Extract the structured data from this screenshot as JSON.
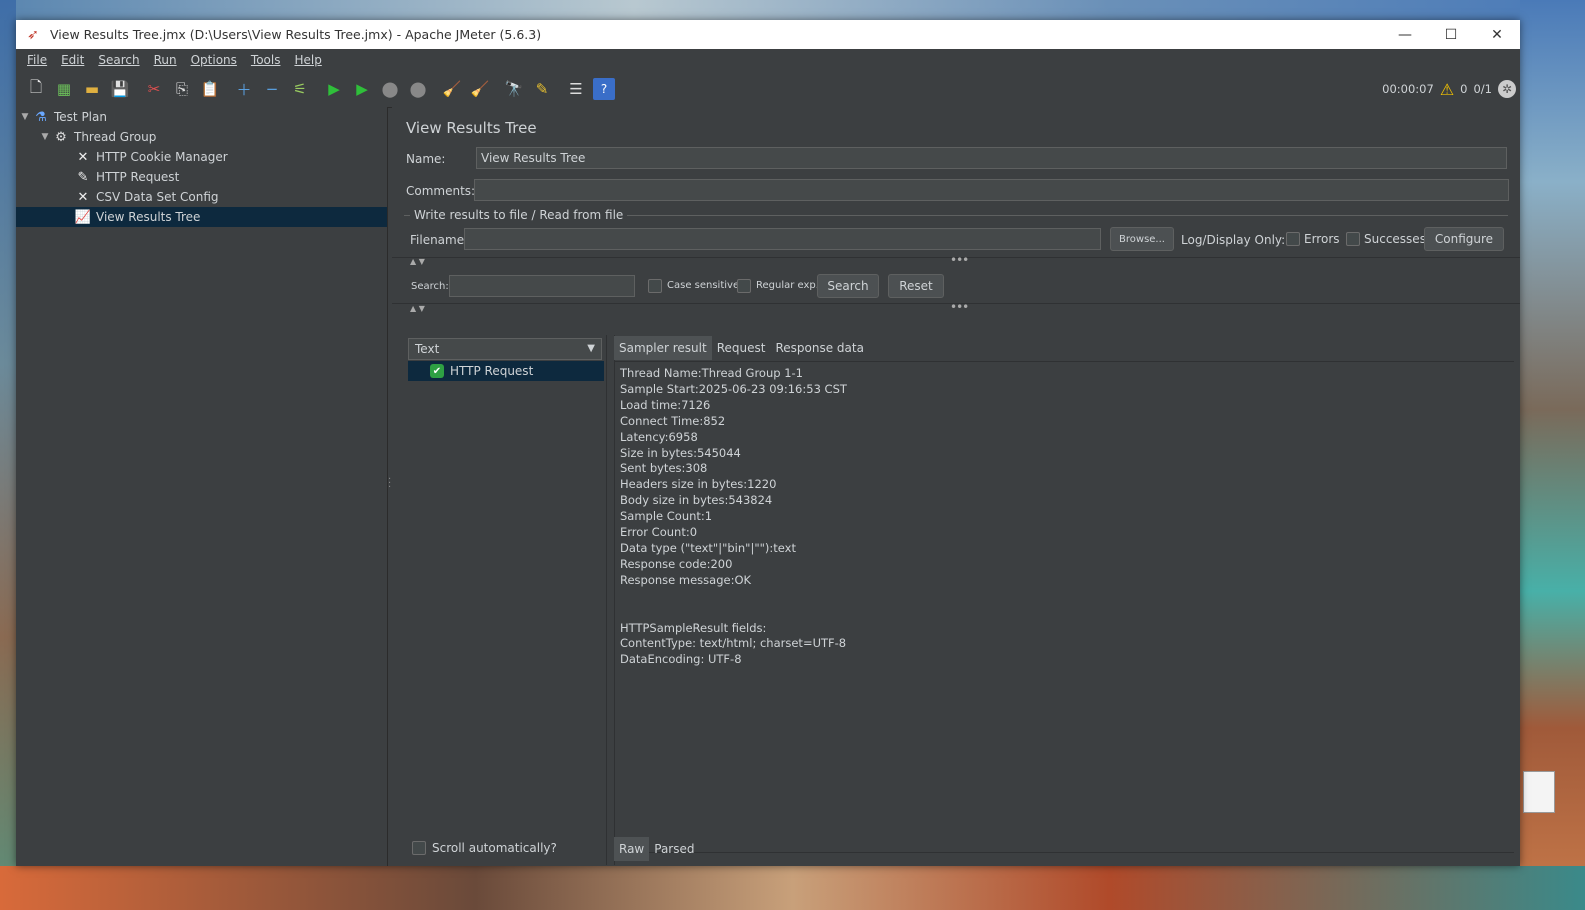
{
  "window": {
    "title": "View Results Tree.jmx (D:\\Users\\View Results Tree.jmx) - Apache JMeter (5.6.3)",
    "controls": [
      "minimize",
      "maximize",
      "close"
    ]
  },
  "menu": [
    {
      "label": "File",
      "mnemonic": "F"
    },
    {
      "label": "Edit",
      "mnemonic": "E"
    },
    {
      "label": "Search",
      "mnemonic": "S"
    },
    {
      "label": "Run",
      "mnemonic": "R"
    },
    {
      "label": "Options",
      "mnemonic": "O"
    },
    {
      "label": "Tools",
      "mnemonic": "T"
    },
    {
      "label": "Help",
      "mnemonic": "H"
    }
  ],
  "toolbar": {
    "elapsed": "00:00:07",
    "warnings": "0",
    "threads": "0/1"
  },
  "tree": [
    {
      "label": "Test Plan",
      "icon": "test-plan-icon"
    },
    {
      "label": "Thread Group",
      "icon": "gear-icon"
    },
    {
      "label": "HTTP Cookie Manager",
      "icon": "tools-icon"
    },
    {
      "label": "HTTP Request",
      "icon": "pipette-icon"
    },
    {
      "label": "CSV Data Set Config",
      "icon": "tools-icon"
    },
    {
      "label": "View Results Tree",
      "icon": "chart-icon",
      "selected": true
    }
  ],
  "panel": {
    "title": "View Results Tree",
    "name_label": "Name:",
    "name_value": "View Results Tree",
    "comments_label": "Comments:",
    "comments_value": "",
    "file_group": "Write results to file / Read from file",
    "filename_label": "Filename",
    "filename_value": "",
    "browse": "Browse...",
    "log_display": "Log/Display Only:",
    "errors": "Errors",
    "successes": "Successes",
    "configure": "Configure"
  },
  "search": {
    "label": "Search:",
    "value": "",
    "case_sensitive": "Case sensitive",
    "regular_exp": "Regular exp.",
    "search_btn": "Search",
    "reset_btn": "Reset"
  },
  "results": {
    "renderer": "Text",
    "items": [
      {
        "label": "HTTP Request",
        "status": "success"
      }
    ],
    "scroll_auto": "Scroll automatically?"
  },
  "tabs": [
    "Sampler result",
    "Request",
    "Response data"
  ],
  "detail_lines": [
    "Thread Name:Thread Group 1-1",
    "Sample Start:2025-06-23 09:16:53 CST",
    "Load time:7126",
    "Connect Time:852",
    "Latency:6958",
    "Size in bytes:545044",
    "Sent bytes:308",
    "Headers size in bytes:1220",
    "Body size in bytes:543824",
    "Sample Count:1",
    "Error Count:0",
    "Data type (\"text\"|\"bin\"|\"\"):text",
    "Response code:200",
    "Response message:OK",
    "",
    "",
    "HTTPSampleResult fields:",
    "ContentType: text/html; charset=UTF-8",
    "DataEncoding: UTF-8"
  ],
  "bottom_tabs": [
    "Raw",
    "Parsed"
  ]
}
